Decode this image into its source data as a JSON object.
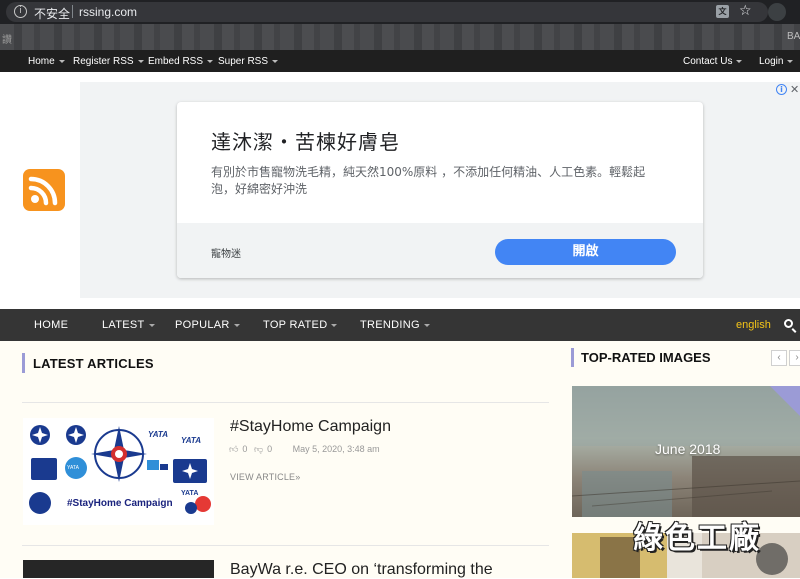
{
  "browser": {
    "security_label": "不安全",
    "url": "rssing.com",
    "bookmarks_left_fragment": "讚",
    "bookmarks_right_fragment": "BA"
  },
  "topnav": {
    "left": [
      {
        "label": "Home"
      },
      {
        "label": "Register RSS"
      },
      {
        "label": "Embed RSS"
      },
      {
        "label": "Super RSS"
      }
    ],
    "right": [
      {
        "label": "Contact Us"
      },
      {
        "label": "Login"
      }
    ]
  },
  "ad": {
    "title": "達沐潔・苦楝好膚皂",
    "body": "有別於市售寵物洗毛精，純天然100%原料 ，不添加任何精油、人工色素。輕鬆起泡，好綿密好沖洗",
    "brand": "寵物迷",
    "cta": "開啟",
    "adchoices_glyph": "i",
    "close_glyph": "✕"
  },
  "mainnav": {
    "items": [
      {
        "label": "HOME"
      },
      {
        "label": "LATEST"
      },
      {
        "label": "POPULAR"
      },
      {
        "label": "TOP RATED"
      },
      {
        "label": "TRENDING"
      }
    ],
    "language": "english"
  },
  "latest": {
    "heading": "LATEST ARTICLES",
    "articles": [
      {
        "title": "#StayHome Campaign",
        "likes": "0",
        "dislikes": "0",
        "date": "May 5, 2020, 3:48 am",
        "link_label": "VIEW ARTICLE",
        "thumb_caption": "#StayHome Campaign",
        "thumb_labels": [
          "YATA",
          "YATA",
          "YATA",
          "YATA"
        ]
      },
      {
        "title": "BayWa r.e. CEO on ‘transforming the"
      }
    ]
  },
  "sidebar": {
    "heading": "TOP-RATED IMAGES",
    "prev_glyph": "‹",
    "next_glyph": "›",
    "images": [
      {
        "label": "June 2018"
      }
    ],
    "watermark": "綠色工廠"
  },
  "colors": {
    "accent": "#9b9bd6",
    "rss_orange": "#f7931e",
    "cta_blue": "#4285f4",
    "language_gold": "#f5c518",
    "nav_dark": "#353535",
    "top_nav_black": "#1f1f1f"
  },
  "icons": {
    "info": "info-circle-icon",
    "translate": "translate-icon",
    "bookmark": "star-icon",
    "rss": "rss-icon",
    "search": "search-icon",
    "like": "thumbs-up-icon",
    "dislike": "thumbs-down-icon"
  }
}
